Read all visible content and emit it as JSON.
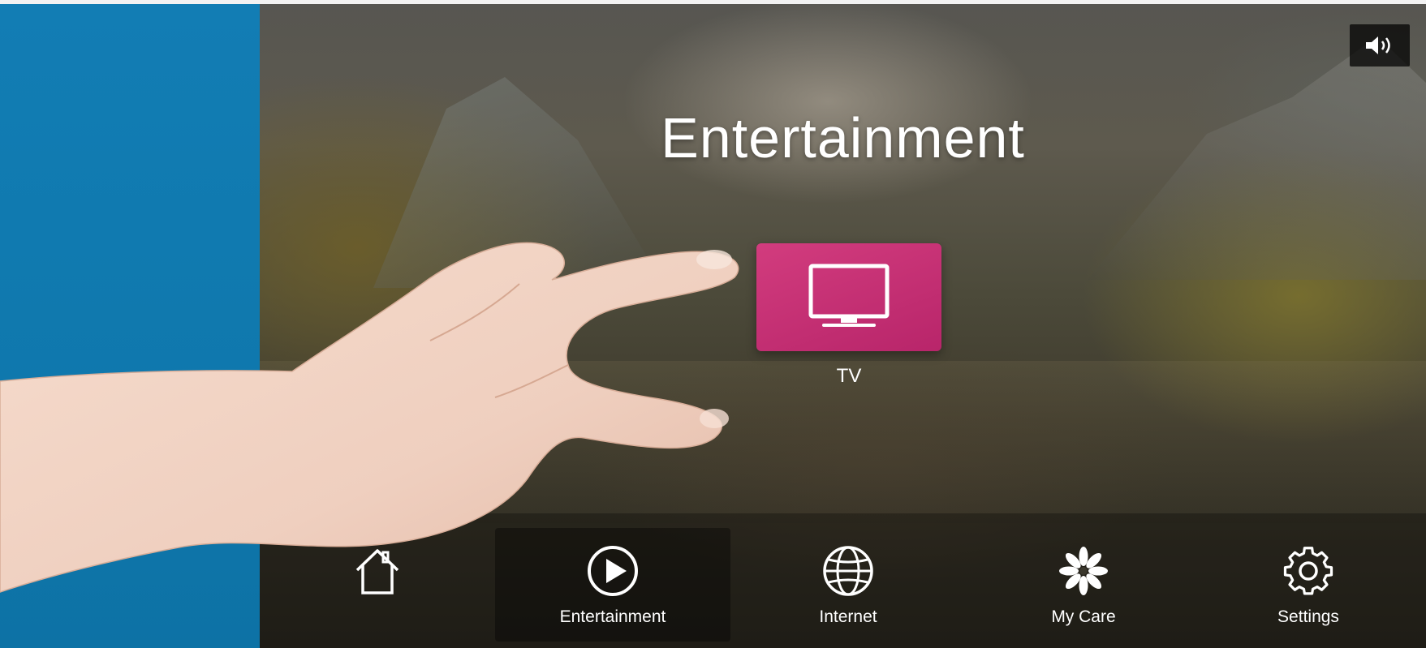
{
  "screen": {
    "title": "Entertainment"
  },
  "tiles": [
    {
      "label": "TV",
      "icon": "tv-icon",
      "color": "#c72f73"
    }
  ],
  "navbar": {
    "items": [
      {
        "label": "",
        "icon": "home-icon"
      },
      {
        "label": "Entertainment",
        "icon": "play-icon",
        "active": true
      },
      {
        "label": "Internet",
        "icon": "globe-icon"
      },
      {
        "label": "My Care",
        "icon": "flower-icon"
      },
      {
        "label": "Settings",
        "icon": "gear-icon"
      }
    ]
  },
  "controls": {
    "volume_icon": "volume-icon"
  },
  "colors": {
    "side_panel": "#127db4",
    "tile_accent": "#c72f73",
    "text": "#ffffff"
  }
}
